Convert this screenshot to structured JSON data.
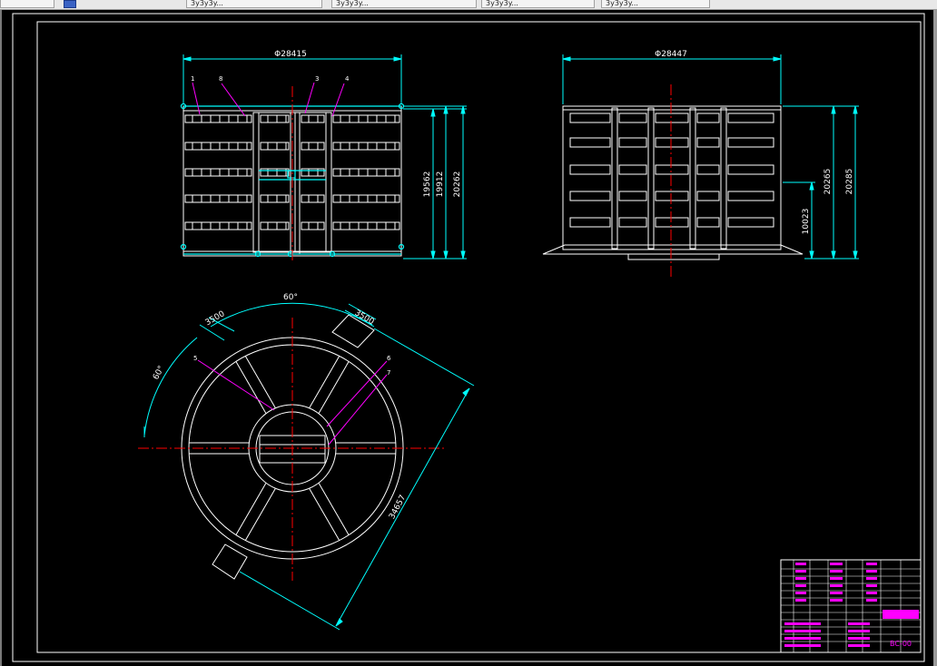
{
  "tabs": [
    {
      "label": ""
    },
    {
      "label": "3y3y3y..."
    },
    {
      "label": "3y3y3y..."
    },
    {
      "label": "3y3y3y..."
    },
    {
      "label": "3y3y3y..."
    }
  ],
  "dims": {
    "front_width": "Φ28415",
    "side_width": "Φ28447",
    "h1": "19562",
    "h2": "19912",
    "h3": "20262",
    "side_h1": "20265",
    "side_h2": "20285",
    "side_h3": "10023",
    "angle_top": "60°",
    "angle_left": "60°",
    "w_left": "3500",
    "w_right": "3500",
    "diag": "34657"
  },
  "balloons": [
    "1",
    "8",
    "3",
    "4",
    "5",
    "6",
    "7"
  ],
  "title_block": {
    "drawing_no": "BC-00"
  },
  "colors": {
    "background": "#000000",
    "geometry": "#ffffff",
    "dimensions": "#00ffff",
    "centerlines": "#ff0000",
    "title_text": "#ff00ff"
  }
}
